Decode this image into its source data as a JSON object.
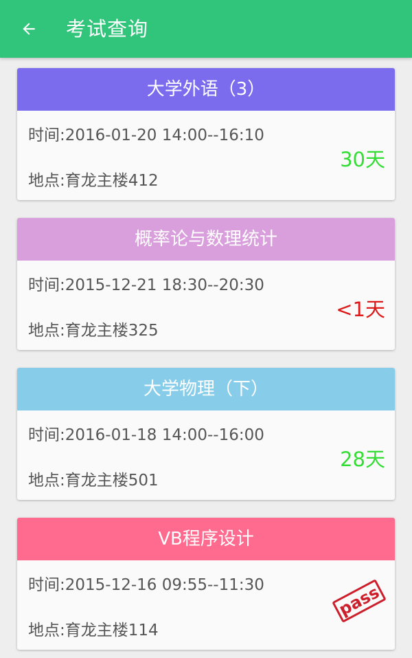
{
  "appbar": {
    "title": "考试查询",
    "back_icon": "arrow-left-icon",
    "background_color": "#30c57a"
  },
  "exams": [
    {
      "name": "大学外语（3）",
      "time": "时间:2016-01-20 14:00--16:10",
      "location": "地点:育龙主楼412",
      "countdown": "30天",
      "header_color": "#7b6cee",
      "status_color": "#33dd33"
    },
    {
      "name": "概率论与数理统计",
      "time": "时间:2015-12-21 18:30--20:30",
      "location": "地点:育龙主楼325",
      "countdown": "<1天",
      "header_color": "#d99edc",
      "status_color": "#dd1a1a"
    },
    {
      "name": "大学物理（下）",
      "time": "时间:2016-01-18 14:00--16:00",
      "location": "地点:育龙主楼501",
      "countdown": "28天",
      "header_color": "#87cdea",
      "status_color": "#33dd33"
    },
    {
      "name": "VB程序设计",
      "time": "时间:2015-12-16 09:55--11:30",
      "location": "地点:育龙主楼114",
      "stamp": "pass",
      "header_color": "#fe6b8f",
      "status_color": "#cc1f2b"
    }
  ]
}
